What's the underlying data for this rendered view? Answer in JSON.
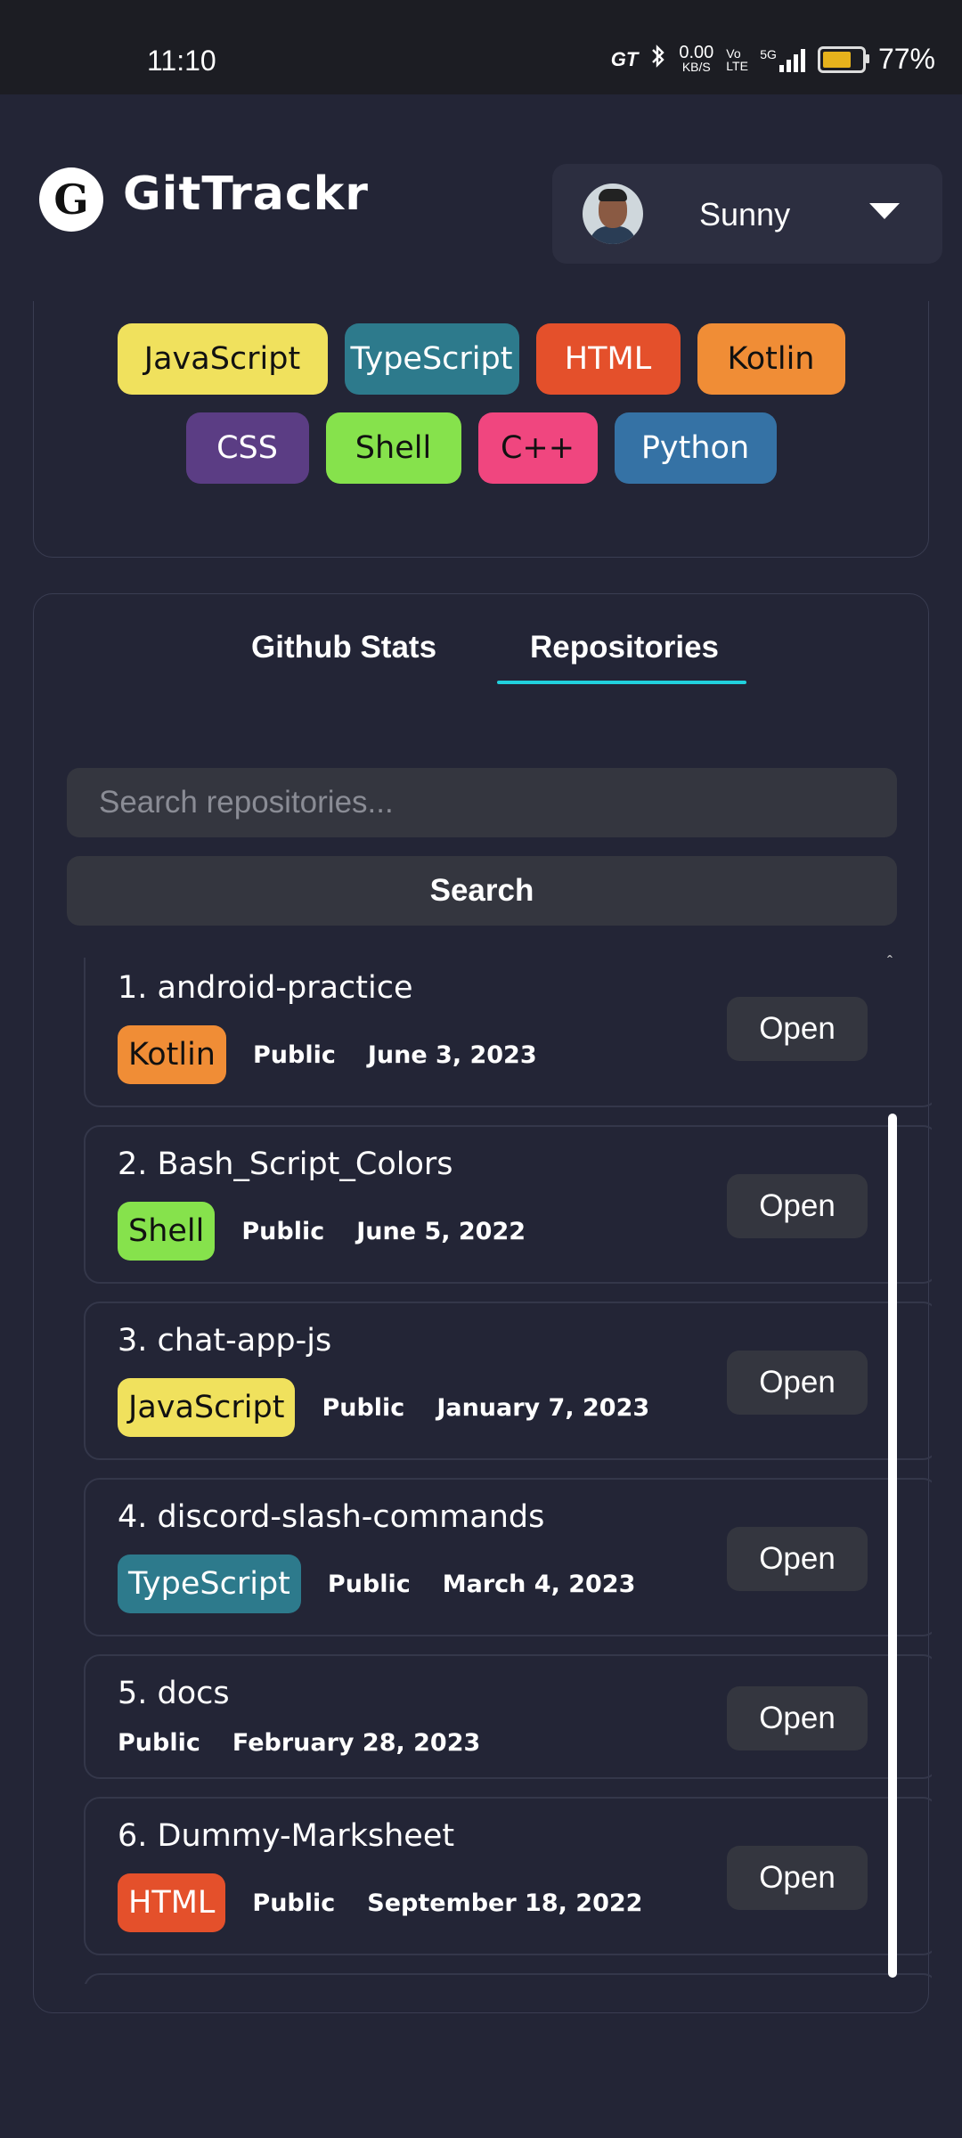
{
  "status_bar": {
    "time": "11:10",
    "net_speed": "0.00",
    "net_unit": "KB/S",
    "gt_label": "GT",
    "bluetooth_icon": "bluetooth-icon",
    "volte": "Vo LTE",
    "signal": "5G",
    "battery_percent": "77%",
    "battery_level": 0.77
  },
  "header": {
    "logo_glyph": "G",
    "title": "GitTrackr",
    "user_name": "Sunny"
  },
  "languages": [
    {
      "label": "JavaScript",
      "color": "#f0e15d",
      "text_color": "#111111"
    },
    {
      "label": "TypeScript",
      "color": "#2d7a8c",
      "text_color": "#ffffff"
    },
    {
      "label": "HTML",
      "color": "#e4502b",
      "text_color": "#ffffff"
    },
    {
      "label": "Kotlin",
      "color": "#f08d36",
      "text_color": "#111111"
    },
    {
      "label": "CSS",
      "color": "#5b3d84",
      "text_color": "#ffffff"
    },
    {
      "label": "Shell",
      "color": "#86e24c",
      "text_color": "#111111"
    },
    {
      "label": "C++",
      "color": "#f0467f",
      "text_color": "#111111"
    },
    {
      "label": "Python",
      "color": "#3572a5",
      "text_color": "#ffffff"
    }
  ],
  "tabs": [
    {
      "label": "Github Stats",
      "active": false
    },
    {
      "label": "Repositories",
      "active": true
    }
  ],
  "search": {
    "placeholder": "Search repositories...",
    "value": "",
    "button_label": "Search"
  },
  "repositories": [
    {
      "index": "1.",
      "name": "android-practice",
      "language": "Kotlin",
      "visibility": "Public",
      "date": "June 3, 2023",
      "button": "Open"
    },
    {
      "index": "2.",
      "name": "Bash_Script_Colors",
      "language": "Shell",
      "visibility": "Public",
      "date": "June 5, 2022",
      "button": "Open"
    },
    {
      "index": "3.",
      "name": "chat-app-js",
      "language": "JavaScript",
      "visibility": "Public",
      "date": "January 7, 2023",
      "button": "Open"
    },
    {
      "index": "4.",
      "name": "discord-slash-commands",
      "language": "TypeScript",
      "visibility": "Public",
      "date": "March 4, 2023",
      "button": "Open"
    },
    {
      "index": "5.",
      "name": "docs",
      "language": "",
      "visibility": "Public",
      "date": "February 28, 2023",
      "button": "Open"
    },
    {
      "index": "6.",
      "name": "Dummy-Marksheet",
      "language": "HTML",
      "visibility": "Public",
      "date": "September 18, 2022",
      "button": "Open"
    }
  ],
  "accent_color": "#21d1dd"
}
